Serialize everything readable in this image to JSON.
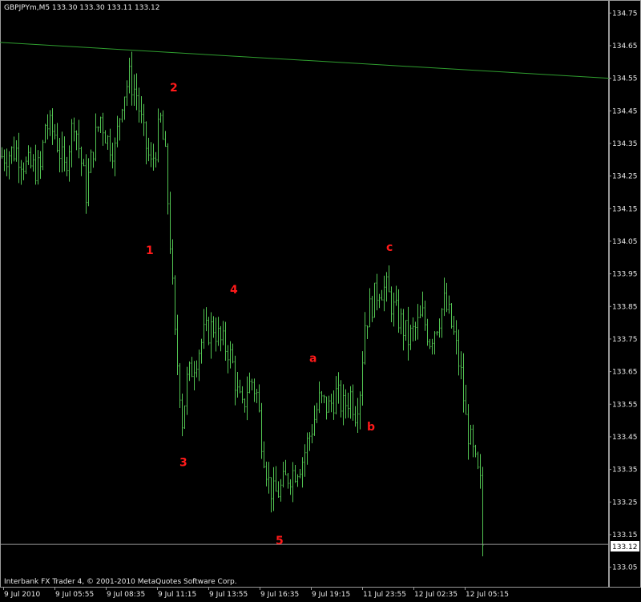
{
  "header": {
    "symbol_line": "GBPJPYm,M5  133.30 133.30 133.11 133.12"
  },
  "footer": {
    "copyright": "Interbank FX Trader 4, © 2001-2010 MetaQuotes Software Corp."
  },
  "colors": {
    "background": "#000000",
    "candles": "#52c452",
    "trendline": "#2f9e2f",
    "price_line": "#9a9a9a",
    "wave_labels": "#ff1a1a",
    "axis_text": "#e8e8e8"
  },
  "chart_data": {
    "type": "bar",
    "symbol": "GBPJPYm",
    "timeframe": "M5",
    "ylim": [
      132.99,
      134.79
    ],
    "y_ticks": [
      "134.75",
      "134.65",
      "134.55",
      "134.45",
      "134.35",
      "134.25",
      "134.15",
      "134.05",
      "133.95",
      "133.85",
      "133.75",
      "133.65",
      "133.55",
      "133.45",
      "133.35",
      "133.25",
      "133.15",
      "133.05"
    ],
    "x_ticks": [
      "9 Jul 2010",
      "9 Jul 05:55",
      "9 Jul 08:35",
      "9 Jul 11:15",
      "9 Jul 13:55",
      "9 Jul 16:35",
      "9 Jul 19:15",
      "11 Jul 23:55",
      "12 Jul 02:35",
      "12 Jul 05:15"
    ],
    "current_price": "133.12",
    "trendline": {
      "start_price": 134.66,
      "end_price": 134.55
    },
    "wave_labels": [
      {
        "text": "1",
        "bar": 60,
        "price": 134.01
      },
      {
        "text": "2",
        "bar": 70,
        "price": 134.51
      },
      {
        "text": "3",
        "bar": 74,
        "price": 133.36
      },
      {
        "text": "4",
        "bar": 95,
        "price": 133.89
      },
      {
        "text": "5",
        "bar": 114,
        "price": 133.12
      },
      {
        "text": "a",
        "bar": 128,
        "price": 133.68
      },
      {
        "text": "b",
        "bar": 152,
        "price": 133.47
      },
      {
        "text": "c",
        "bar": 160,
        "price": 134.02
      }
    ],
    "price_path": [
      [
        0,
        134.31
      ],
      [
        6,
        134.33
      ],
      [
        10,
        134.28
      ],
      [
        16,
        134.27
      ],
      [
        18,
        134.41
      ],
      [
        22,
        134.38
      ],
      [
        26,
        134.27
      ],
      [
        30,
        134.43
      ],
      [
        35,
        134.2
      ],
      [
        38,
        134.34
      ],
      [
        41,
        134.43
      ],
      [
        44,
        134.36
      ],
      [
        47,
        134.33
      ],
      [
        50,
        134.49
      ],
      [
        53,
        134.55
      ],
      [
        56,
        134.5
      ],
      [
        59,
        134.37
      ],
      [
        62,
        134.28
      ],
      [
        64,
        134.34
      ],
      [
        66,
        134.42
      ],
      [
        68,
        134.3
      ],
      [
        70,
        134.05
      ],
      [
        72,
        133.75
      ],
      [
        74,
        133.6
      ],
      [
        75,
        133.5
      ],
      [
        77,
        133.62
      ],
      [
        80,
        133.68
      ],
      [
        84,
        133.76
      ],
      [
        88,
        133.79
      ],
      [
        91,
        133.74
      ],
      [
        94,
        133.72
      ],
      [
        96,
        133.67
      ],
      [
        98,
        133.58
      ],
      [
        100,
        133.53
      ],
      [
        102,
        133.6
      ],
      [
        104,
        133.62
      ],
      [
        106,
        133.58
      ],
      [
        108,
        133.45
      ],
      [
        111,
        133.31
      ],
      [
        113,
        133.27
      ],
      [
        116,
        133.29
      ],
      [
        119,
        133.33
      ],
      [
        122,
        133.35
      ],
      [
        125,
        133.38
      ],
      [
        129,
        133.48
      ],
      [
        132,
        133.56
      ],
      [
        136,
        133.54
      ],
      [
        139,
        133.58
      ],
      [
        142,
        133.54
      ],
      [
        145,
        133.58
      ],
      [
        147,
        133.53
      ],
      [
        149,
        133.6
      ],
      [
        151,
        133.8
      ],
      [
        154,
        133.86
      ],
      [
        157,
        133.91
      ],
      [
        160,
        133.9
      ],
      [
        163,
        133.84
      ],
      [
        166,
        133.8
      ],
      [
        169,
        133.75
      ],
      [
        172,
        133.78
      ],
      [
        175,
        133.82
      ],
      [
        178,
        133.75
      ],
      [
        181,
        133.8
      ],
      [
        184,
        133.86
      ],
      [
        186,
        133.82
      ],
      [
        188,
        133.76
      ],
      [
        191,
        133.64
      ],
      [
        193,
        133.5
      ],
      [
        195,
        133.43
      ],
      [
        197,
        133.36
      ],
      [
        199,
        133.3
      ],
      [
        200,
        133.12
      ]
    ]
  }
}
